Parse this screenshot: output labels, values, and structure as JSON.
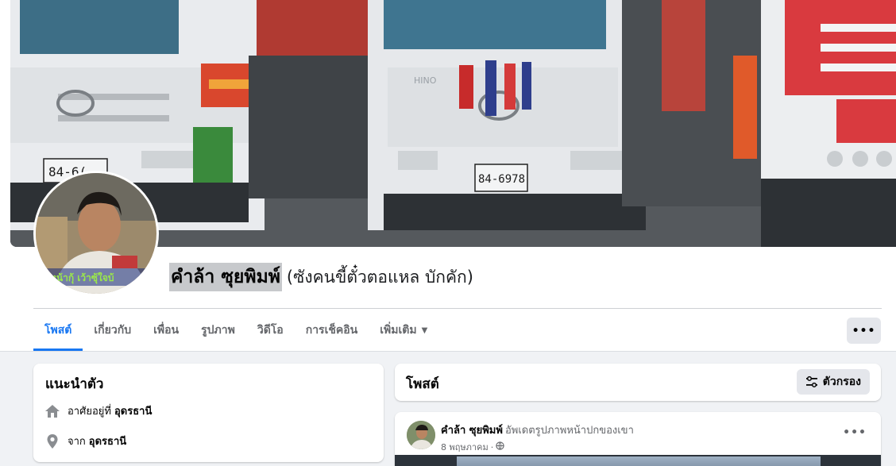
{
  "profile": {
    "name": "คำล้า ซุยพิมพ์",
    "alternate_name": "(ซังคนขี้ตั๋วตอแหล บักคัก)",
    "cover_plate_left": "84-6(…",
    "cover_plate_center": "84-6978",
    "cover_grill_text": "HINO",
    "avatar_overlay_text": "เพหน้ากุ้ เว้าซุ้ใจบ้"
  },
  "tabs": [
    {
      "label": "โพสต์",
      "active": true
    },
    {
      "label": "เกี่ยวกับ",
      "active": false
    },
    {
      "label": "เพื่อน",
      "active": false
    },
    {
      "label": "รูปภาพ",
      "active": false
    },
    {
      "label": "วิดีโอ",
      "active": false
    },
    {
      "label": "การเช็คอิน",
      "active": false
    },
    {
      "label": "เพิ่มเติม",
      "active": false
    }
  ],
  "more_button": "•••",
  "intro": {
    "title": "แนะนำตัว",
    "lives_prefix": "อาศัยอยู่ที่",
    "lives_place": "อุดรธานี",
    "from_prefix": "จาก",
    "from_place": "อุดรธานี"
  },
  "posts": {
    "title": "โพสต์",
    "filter_label": "ตัวกรอง"
  },
  "post": {
    "author": "คำล้า ซุยพิมพ์",
    "action": "อัพเดตรูปภาพหน้าปกของเขา",
    "date": "8 พฤษภาคม",
    "separator": "·",
    "menu": "•••"
  },
  "colors": {
    "accent": "#1877f2",
    "background": "#f0f2f5",
    "secondary_text": "#65676b",
    "button_gray": "#e4e6eb"
  }
}
